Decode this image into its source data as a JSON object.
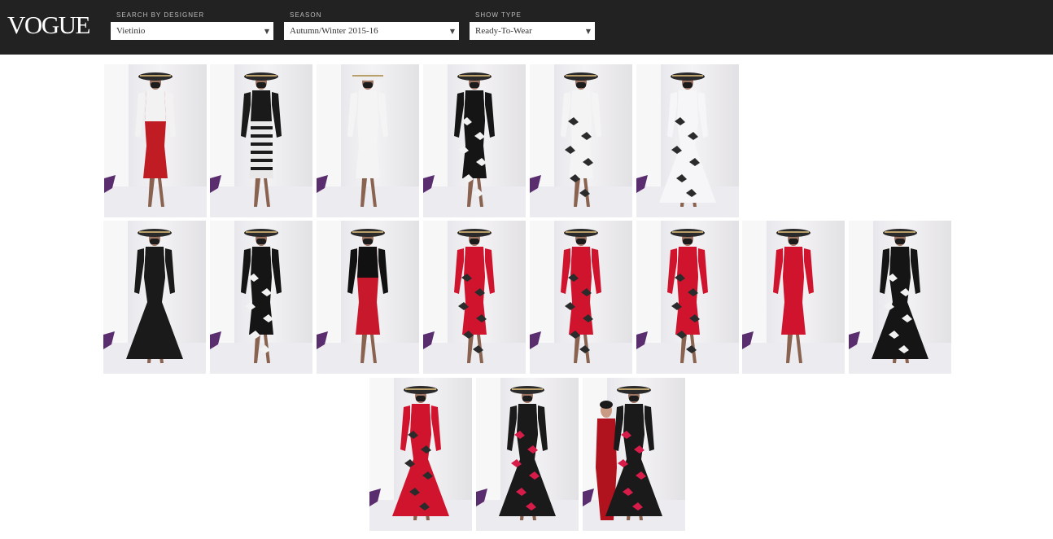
{
  "header": {
    "logo": "VOGUE",
    "filters": [
      {
        "label": "SEARCH BY DESIGNER",
        "value": "Vietinio"
      },
      {
        "label": "SEASON",
        "value": "Autumn/Winter 2015-16"
      },
      {
        "label": "SHOW TYPE",
        "value": "Ready-To-Wear"
      }
    ]
  },
  "icons": {
    "dropdown": "caret-down-icon"
  },
  "colors": {
    "header_bg": "#222222",
    "red": "#c8182b",
    "black": "#111111",
    "white": "#f4f4f4"
  },
  "looks": [
    {
      "top": "#f2f2f2",
      "bottom": "#c01c24",
      "pattern": "none",
      "hat": "#2a2a2a",
      "gown": false
    },
    {
      "top": "#1a1a1a",
      "bottom": "#e8e8e8",
      "pattern": "stripe",
      "hat": "#2a2a2a",
      "gown": false
    },
    {
      "top": "#f4f4f4",
      "bottom": "#f4f4f4",
      "pattern": "none",
      "hat": "#eeeeee",
      "gown": false
    },
    {
      "top": "#151515",
      "bottom": "#151515",
      "pattern": "white-print",
      "hat": "#2a2a2a",
      "gown": false
    },
    {
      "top": "#f4f4f4",
      "bottom": "#f4f4f4",
      "pattern": "dark-print",
      "hat": "#2a2a2a",
      "gown": false
    },
    {
      "top": "#f6f6f8",
      "bottom": "#f6f6f8",
      "pattern": "dark-print",
      "hat": "#2a2a2a",
      "gown": true
    },
    {
      "top": "#1a1a1a",
      "bottom": "#1a1a1a",
      "pattern": "none",
      "hat": "#2a2a2a",
      "gown": true
    },
    {
      "top": "#151515",
      "bottom": "#151515",
      "pattern": "white-print",
      "hat": "#2a2a2a",
      "gown": false
    },
    {
      "top": "#111111",
      "bottom": "#c8182b",
      "pattern": "none",
      "hat": "#2a2a2a",
      "gown": false
    },
    {
      "top": "#d0142e",
      "bottom": "#d0142e",
      "pattern": "dark-print",
      "hat": "#2a2a2a",
      "gown": false
    },
    {
      "top": "#d0142e",
      "bottom": "#d0142e",
      "pattern": "dark-print",
      "hat": "#2a2a2a",
      "gown": false
    },
    {
      "top": "#d0142e",
      "bottom": "#d0142e",
      "pattern": "dark-print",
      "hat": "#2a2a2a",
      "gown": false
    },
    {
      "top": "#d0142e",
      "bottom": "#d0142e",
      "pattern": "none",
      "hat": "#2a2a2a",
      "gown": false
    },
    {
      "top": "#151515",
      "bottom": "#151515",
      "pattern": "white-print",
      "hat": "#2a2a2a",
      "gown": true
    },
    {
      "top": "#d0142e",
      "bottom": "#d0142e",
      "pattern": "dark-print",
      "hat": "#2a2a2a",
      "gown": true
    },
    {
      "top": "#1a1a1a",
      "bottom": "#1a1a1a",
      "pattern": "red-print",
      "hat": "#2a2a2a",
      "gown": true
    },
    {
      "top": "#1a1a1a",
      "bottom": "#1a1a1a",
      "pattern": "red-print",
      "hat": "#2a2a2a",
      "gown": true,
      "companion": "#b0121e"
    }
  ]
}
